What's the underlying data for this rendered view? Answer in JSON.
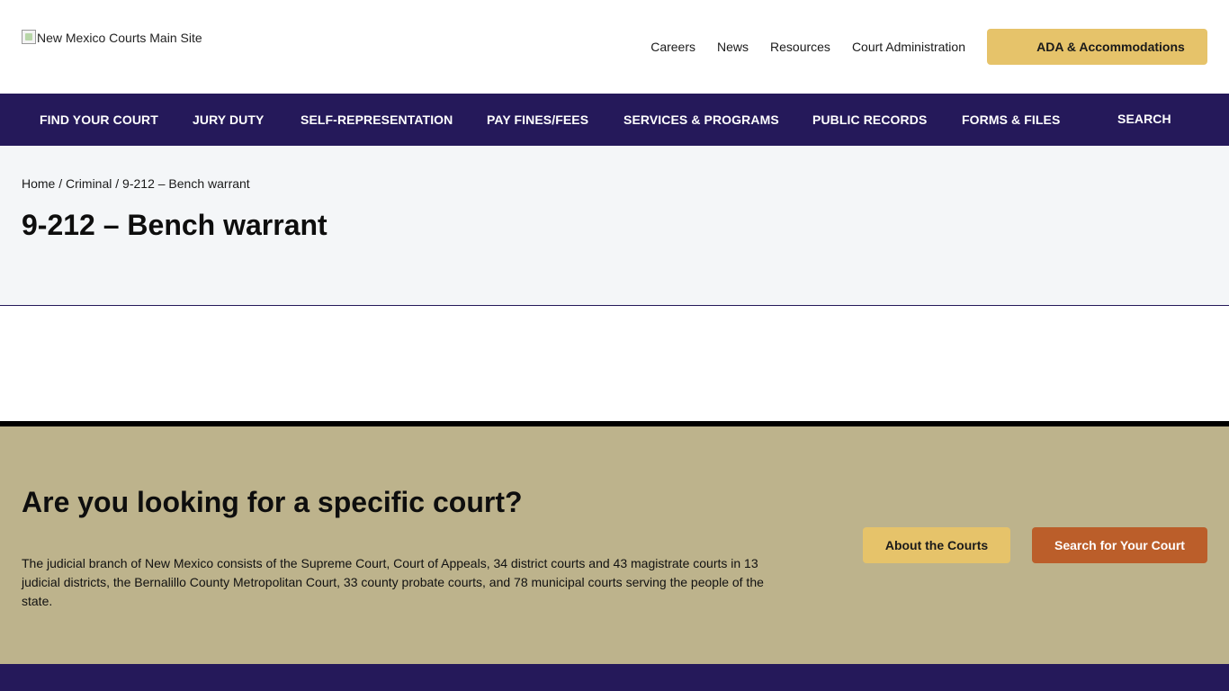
{
  "header": {
    "logo_alt": "New Mexico Courts Main Site",
    "top_links": [
      "Careers",
      "News",
      "Resources",
      "Court Administration"
    ],
    "ada_label": "ADA & Accommodations"
  },
  "nav": {
    "items": [
      "FIND YOUR COURT",
      "JURY DUTY",
      "SELF-REPRESENTATION",
      "PAY FINES/FEES",
      "SERVICES & PROGRAMS",
      "PUBLIC RECORDS",
      "FORMS & FILES"
    ],
    "search_label": "SEARCH"
  },
  "breadcrumb": {
    "home": "Home",
    "sep1": " / ",
    "parent": "Criminal",
    "sep2": " / ",
    "current": "9-212 – Bench warrant"
  },
  "page": {
    "title": "9-212 – Bench warrant"
  },
  "court_cta": {
    "title": "Are you looking for a specific court?",
    "text": "The judicial branch of New Mexico consists of the Supreme Court, Court of Appeals, 34 district courts and 43 magistrate courts in 13 judicial districts, the Bernalillo County Metropolitan Court, 33 county probate courts, and 78 municipal courts serving the people of the state.",
    "about_label": "About the Courts",
    "search_label": "Search for Your Court"
  },
  "colors": {
    "nav_bg": "#25195a",
    "gold": "#e6c36a",
    "tan": "#bdb38c",
    "rust": "#bb5e2a"
  }
}
